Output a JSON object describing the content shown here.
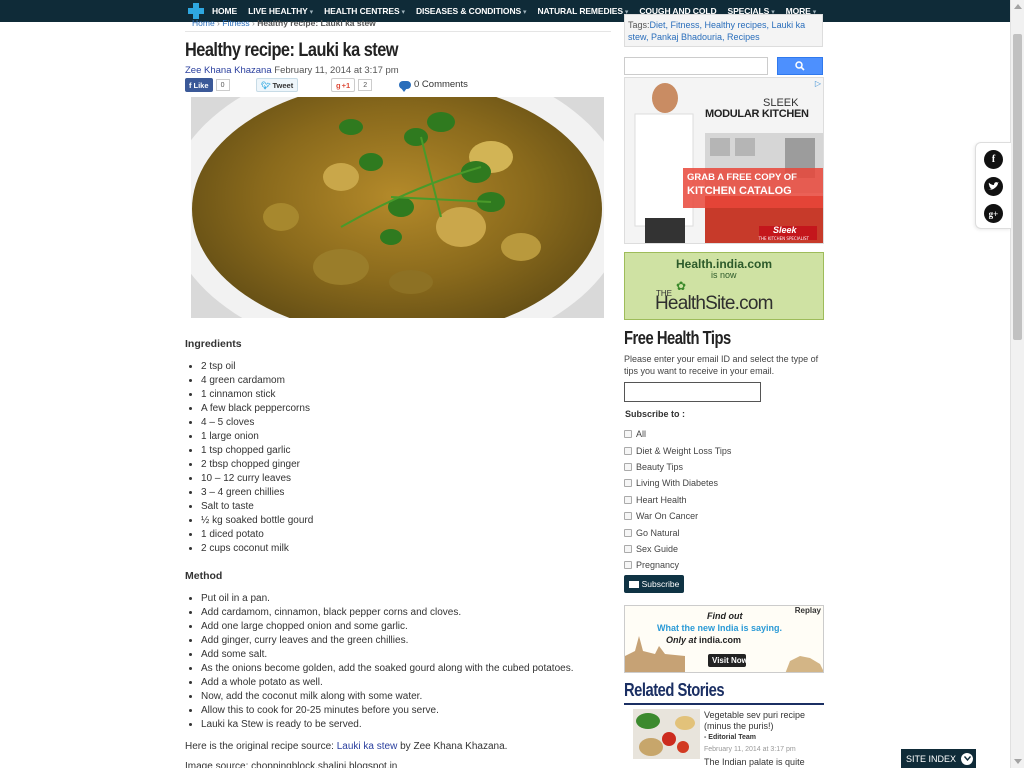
{
  "nav": {
    "items": [
      {
        "label": "HOME",
        "dropdown": false
      },
      {
        "label": "LIVE HEALTHY",
        "dropdown": true
      },
      {
        "label": "HEALTH CENTRES",
        "dropdown": true
      },
      {
        "label": "DISEASES & CONDITIONS",
        "dropdown": true
      },
      {
        "label": "NATURAL REMEDIES",
        "dropdown": true
      },
      {
        "label": "COUGH AND COLD",
        "dropdown": false
      },
      {
        "label": "SPECIALS",
        "dropdown": true
      },
      {
        "label": "MORE",
        "dropdown": true
      }
    ]
  },
  "breadcrumb": {
    "home": "Home",
    "sep1": " › ",
    "section": "Fitness",
    "sep2": " › ",
    "current": "Healthy recipe: Lauki ka stew"
  },
  "article": {
    "title": "Healthy recipe: Lauki ka stew",
    "author": "Zee Khana Khazana",
    "date": " February 11, 2014 at 3:17 pm",
    "share": {
      "fb_label": "Like",
      "fb_count": "0",
      "tw_label": "Tweet",
      "gp_label": "+1",
      "gp_count": "2"
    },
    "comments": "0 Comments",
    "ingredients_heading": "Ingredients",
    "ingredients": [
      "2 tsp oil",
      "4 green cardamom",
      "1 cinnamon stick",
      "A few black peppercorns",
      "4 – 5 cloves",
      "1 large onion",
      "1 tsp chopped garlic",
      "2 tbsp chopped ginger",
      "10 – 12 curry leaves",
      "3 – 4 green chillies",
      "Salt to taste",
      "½ kg soaked bottle gourd",
      "1 diced potato",
      "2 cups coconut milk"
    ],
    "method_heading": "Method",
    "method": [
      "Put oil in a pan.",
      "Add cardamom, cinnamon, black pepper corns and cloves.",
      "Add one large chopped onion and some garlic.",
      "Add ginger, curry leaves and the green chillies.",
      "Add some salt.",
      "As the onions become golden, add the soaked gourd along with the cubed potatoes.",
      "Add a whole potato as well.",
      "Now, add the coconut milk along with some water.",
      "Allow this to cook for 20-25 minutes before you serve.",
      "Lauki ka Stew is ready to be served."
    ],
    "source_prefix": "Here is the original recipe source: ",
    "source_link": "Lauki ka stew",
    "source_suffix": " by Zee Khana Khazana.",
    "image_source": "Image source: choppingblock.shalini.blogspot.in"
  },
  "sidebar": {
    "tags_label": "Tags:",
    "tags": "Diet, Fitness, Healthy recipes, Lauki ka stew, Pankaj Bhadouria, Recipes",
    "search_placeholder": "",
    "ad1": {
      "line1": "SLEEK",
      "line2": "MODULAR KITCHEN",
      "cta1": "GRAB A FREE COPY OF",
      "cta2": "KITCHEN CATALOG",
      "brand": "Sleek"
    },
    "ad2": {
      "line1": "Health.india.com",
      "line2": "is now",
      "brand_prefix": "THE",
      "brand": "HealthSite",
      "brand_suffix": ".com"
    },
    "free_tips": {
      "title": "Free Health Tips",
      "desc": "Please enter your email ID and select the type of tips you want to receive in your email.",
      "subscribe_to": "Subscribe to :",
      "options": [
        "All",
        "Diet & Weight Loss Tips",
        "Beauty Tips",
        "Living With Diabetes",
        "Heart Health",
        "War On Cancer",
        "Go Natural",
        "Sex Guide",
        "Pregnancy"
      ],
      "button": "Subscribe"
    },
    "ad3": {
      "replay": "Replay",
      "line1": "Find out",
      "line2": "What the new India is saying.",
      "line3_prefix": "Only at ",
      "line3_brand": "india.com",
      "cta": "Visit Now!"
    },
    "related": {
      "title": "Related Stories",
      "headline": "Vegetable sev puri recipe (minus the puris!)",
      "team": "- Editorial Team",
      "date": "February 11, 2014 at 3:17 pm",
      "snippet": "The Indian palate is quite"
    }
  },
  "float_social": {
    "facebook": "f",
    "twitter": "t",
    "gplus": "g+"
  },
  "site_index": "SITE INDEX",
  "colors": {
    "nav_bg": "#0f2b38",
    "link": "#2a6ebb",
    "author": "#2a3f9e",
    "related_title": "#1b2f63",
    "search_button": "#4d90fe"
  }
}
